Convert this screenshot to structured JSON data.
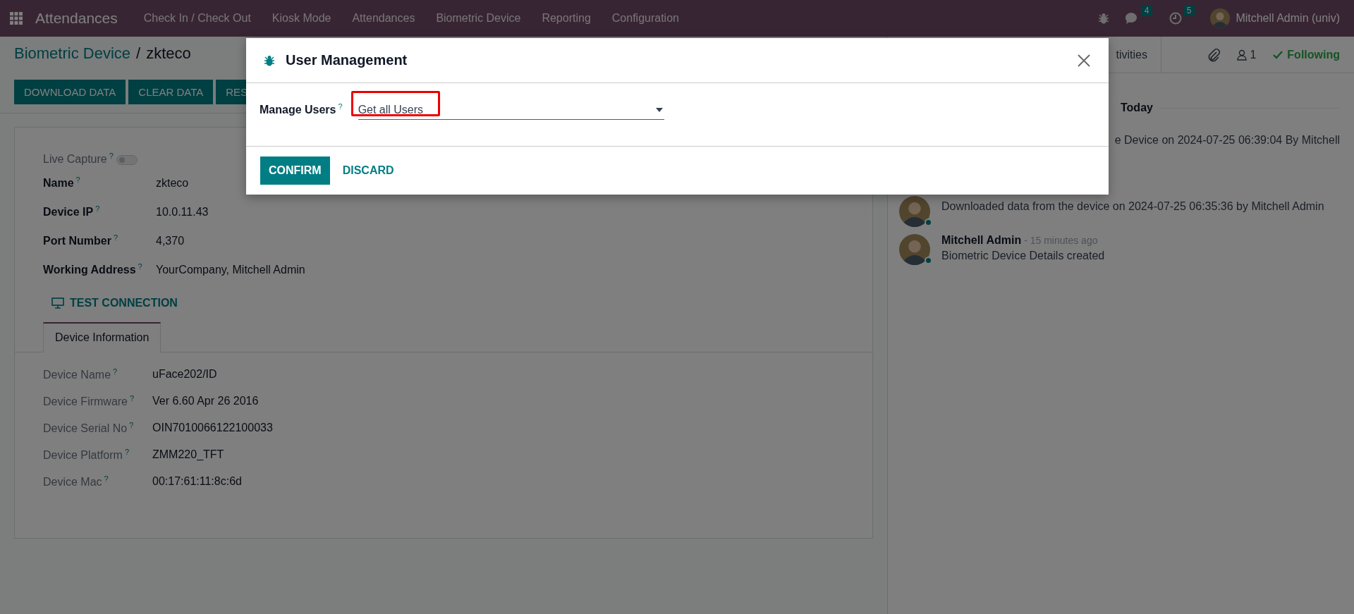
{
  "navbar": {
    "app": "Attendances",
    "menu": [
      "Check In / Check Out",
      "Kiosk Mode",
      "Attendances",
      "Biometric Device",
      "Reporting",
      "Configuration"
    ],
    "messages_count": "4",
    "activities_count": "5",
    "user": "Mitchell Admin (univ)"
  },
  "breadcrumb": {
    "parent": "Biometric Device",
    "separator": "/",
    "current": "zkteco"
  },
  "actions": [
    "DOWNLOAD DATA",
    "CLEAR DATA",
    "RES"
  ],
  "form": {
    "fields": [
      {
        "kind": "toggle",
        "label": "Live Capture",
        "help": "?",
        "on": false
      },
      {
        "kind": "text",
        "label": "Name",
        "help": "?",
        "value": "zkteco"
      },
      {
        "kind": "text",
        "label": "Device IP",
        "help": "?",
        "value": "10.0.11.43"
      },
      {
        "kind": "text",
        "label": "Port Number",
        "help": "?",
        "value": "4,370"
      },
      {
        "kind": "text",
        "label": "Working Address",
        "help": "?",
        "value": "YourCompany, Mitchell Admin"
      }
    ],
    "test_button": "TEST CONNECTION",
    "tabs": [
      {
        "label": "Device Information",
        "selected": true
      }
    ],
    "info": [
      {
        "label": "Device Name",
        "help": "?",
        "value": "uFace202/ID"
      },
      {
        "label": "Device Firmware",
        "help": "?",
        "value": "Ver 6.60 Apr 26 2016"
      },
      {
        "label": "Device Serial No",
        "help": "?",
        "value": "OIN7010066122100033"
      },
      {
        "label": "Device Platform",
        "help": "?",
        "value": "ZMM220_TFT"
      },
      {
        "label": "Device Mac",
        "help": "?",
        "value": "00:17:61:11:8c:6d"
      }
    ]
  },
  "chatter": {
    "tab": "tivities",
    "followers": "1",
    "follow_label": "Following",
    "date": "Today",
    "messages": [
      {
        "text": "e Device on 2024-07-25 06:39:04 By Mitchell",
        "avatar": false
      },
      {
        "text": "Downloaded data from the device on 2024-07-25 06:35:36 by Mitchell Admin",
        "avatar": true
      },
      {
        "author": "Mitchell Admin",
        "time": "- 15 minutes ago",
        "text": "Biometric Device Details created",
        "avatar": true
      }
    ]
  },
  "dialog": {
    "title": "User Management",
    "field": {
      "label": "Manage Users",
      "help": "?",
      "value": "Get all Users",
      "highlighted": true
    },
    "buttons": [
      {
        "label": "CONFIRM",
        "kind": "primary"
      },
      {
        "label": "DISCARD",
        "kind": "link"
      }
    ]
  }
}
